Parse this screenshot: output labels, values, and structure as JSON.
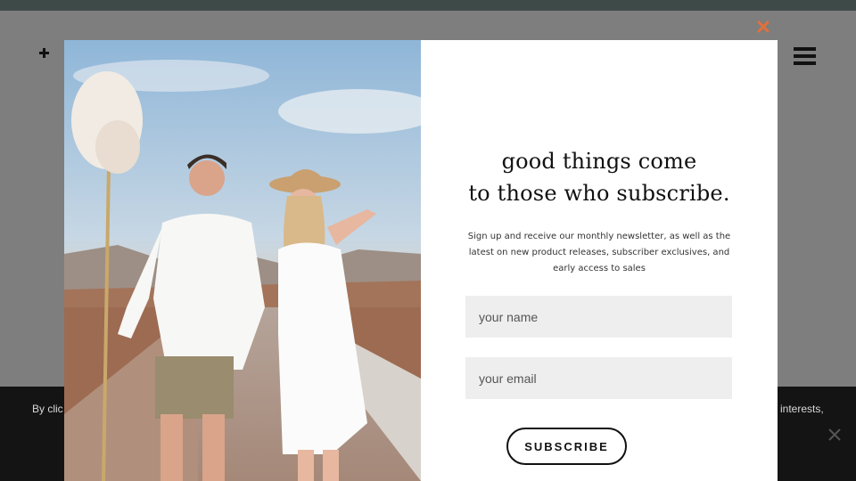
{
  "popup": {
    "headline_line1": "good things come",
    "headline_line2": "to those who subscribe.",
    "description": "Sign up and receive our monthly newsletter, as well as the latest on new product releases, subscriber exclusives, and early access to sales",
    "name_placeholder": "your name",
    "email_placeholder": "your email",
    "subscribe_label": "SUBSCRIBE",
    "close_icon": "close-icon",
    "accent_color": "#e2703a"
  },
  "cookie_bar": {
    "text_left": "By clic",
    "text_right": "interests,"
  },
  "header": {
    "plus_icon": "plus-icon",
    "menu_icon": "hamburger-icon"
  }
}
